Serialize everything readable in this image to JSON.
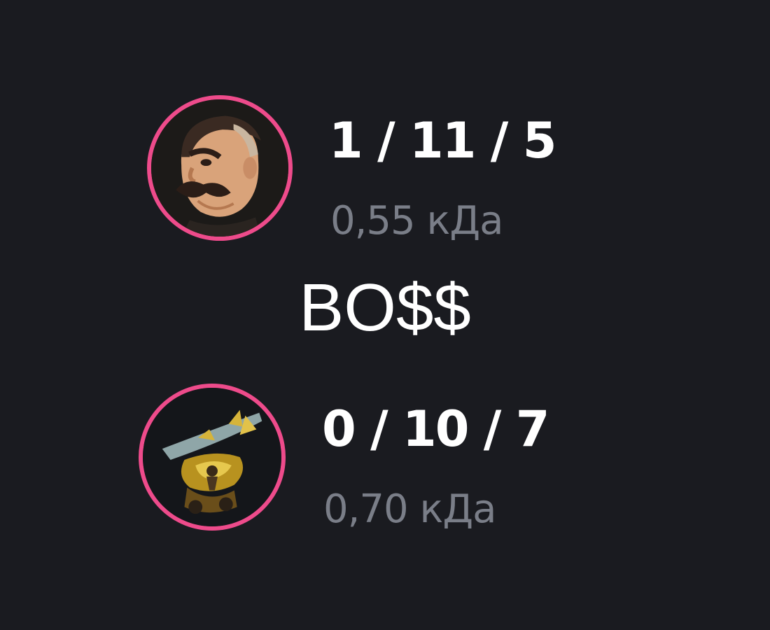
{
  "players": [
    {
      "kda": "1 / 11 / 5",
      "ratio": "0,55 кДа",
      "icon": "mustached-hero-portrait-icon",
      "ring_color": "#ee4b8b"
    },
    {
      "kda": "0 / 10 / 7",
      "ratio": "0,70 кДа",
      "icon": "golden-vehicle-hero-portrait-icon",
      "ring_color": "#ee4b8b"
    }
  ],
  "caption": "BO$$",
  "colors": {
    "background": "#1a1b20",
    "kda_text": "#ffffff",
    "ratio_text": "#7a7e88"
  }
}
